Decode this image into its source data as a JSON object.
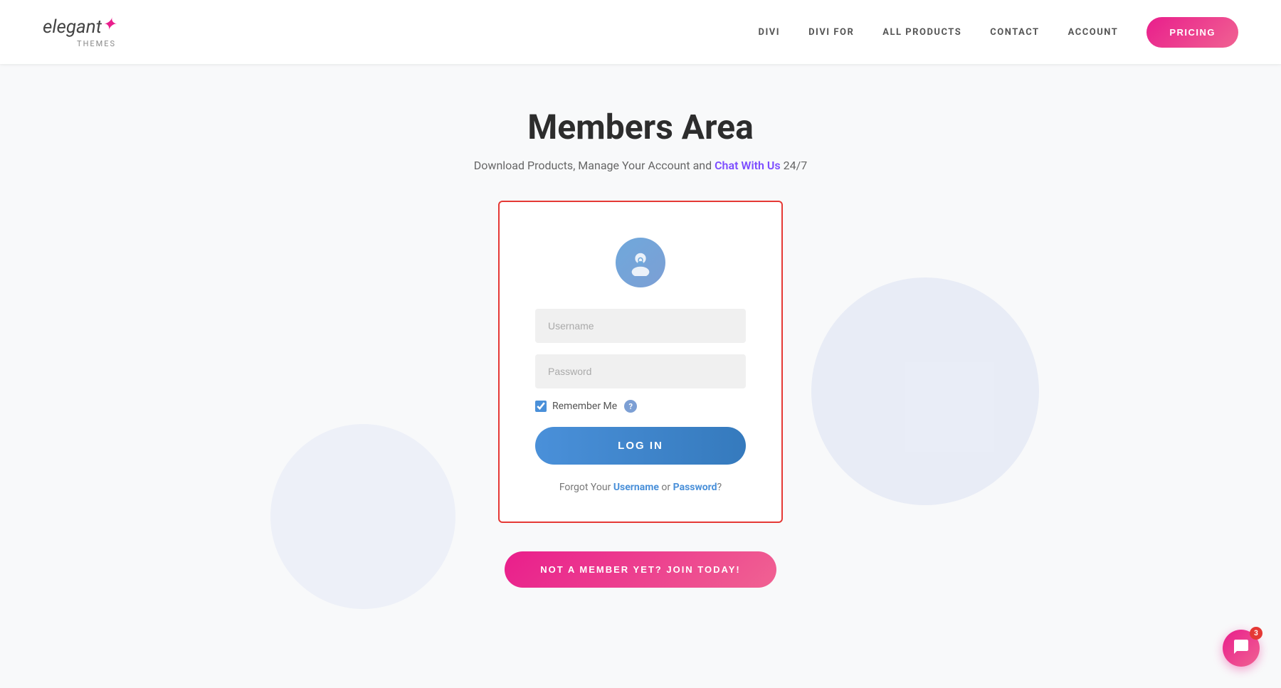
{
  "header": {
    "logo": {
      "elegant": "elegant",
      "star": "✦",
      "themes": "themes"
    },
    "nav": {
      "items": [
        {
          "id": "divi",
          "label": "DIVI"
        },
        {
          "id": "divi-for",
          "label": "DIVI FOR"
        },
        {
          "id": "all-products",
          "label": "ALL PRODUCTS"
        },
        {
          "id": "contact",
          "label": "CONTACT"
        },
        {
          "id": "account",
          "label": "ACCOUNT"
        }
      ],
      "pricing_label": "PRICING"
    }
  },
  "main": {
    "title": "Members Area",
    "subtitle_pre": "Download Products, Manage Your Account and ",
    "subtitle_chat": "Chat With Us",
    "subtitle_post": " 24/7"
  },
  "login": {
    "username_placeholder": "Username",
    "password_placeholder": "Password",
    "remember_label": "Remember Me",
    "login_button": "LOG IN",
    "forgot_pre": "Forgot Your ",
    "forgot_username": "Username",
    "forgot_mid": " or ",
    "forgot_password": "Password",
    "forgot_post": "?"
  },
  "join": {
    "label": "NOT A MEMBER YET? JOIN TODAY!"
  },
  "chat_widget": {
    "badge_count": "3",
    "icon": "💬"
  }
}
